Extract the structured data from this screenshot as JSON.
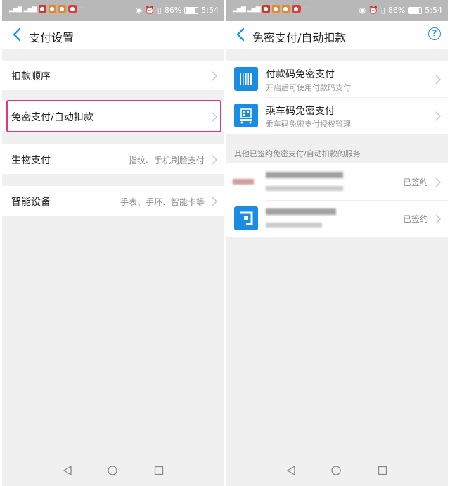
{
  "status": {
    "battery_percent": "86%",
    "time": "5:54"
  },
  "left": {
    "header": {
      "title": "支付设置"
    },
    "rows": [
      {
        "label": "扣款顺序",
        "value": ""
      },
      {
        "label": "免密支付/自动扣款",
        "value": ""
      },
      {
        "label": "生物支付",
        "value": "指纹、手机刷脸支付"
      },
      {
        "label": "智能设备",
        "value": "手表、手环、智能卡等"
      }
    ]
  },
  "right": {
    "header": {
      "title": "免密支付/自动扣款"
    },
    "items": [
      {
        "title": "付款码免密支付",
        "subtitle": "开启后可使用付款码支付",
        "icon": "barcode-icon"
      },
      {
        "title": "乘车码免密支付",
        "subtitle": "乘车码免密支付授权管理",
        "icon": "bus-code-icon"
      }
    ],
    "section_label": "其他已签约免密支付/自动扣款的服务",
    "services": [
      {
        "status": "已签约"
      },
      {
        "status": "已签约"
      }
    ]
  },
  "colors": {
    "accent": "#1a9ad8",
    "icon_blue": "#1a8de3",
    "highlight": "#e0368a",
    "status_bar": "#b8b8b8",
    "background": "#f0f0f0"
  }
}
